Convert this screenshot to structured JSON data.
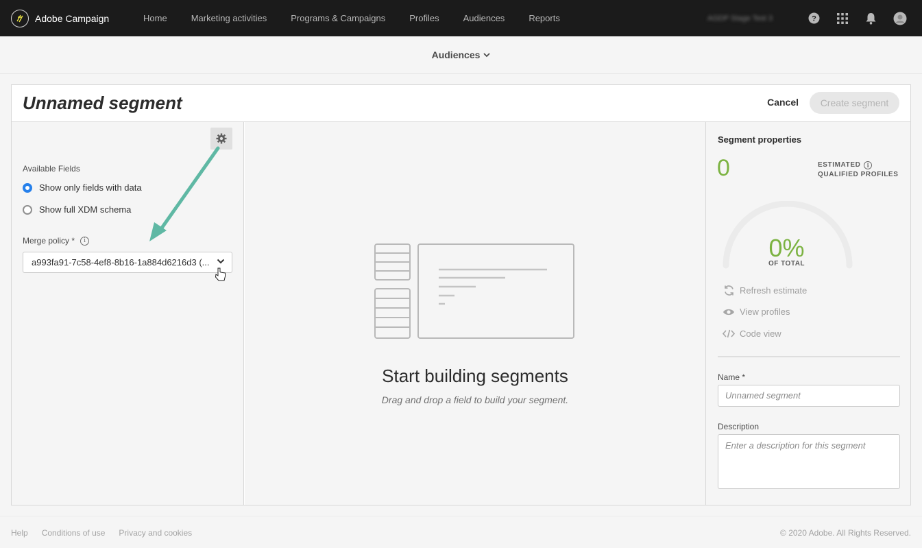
{
  "app": {
    "name": "Adobe Campaign",
    "org_name": "AGDP Stage Test 3"
  },
  "topnav": {
    "items": [
      {
        "label": "Home"
      },
      {
        "label": "Marketing activities"
      },
      {
        "label": "Programs & Campaigns"
      },
      {
        "label": "Profiles"
      },
      {
        "label": "Audiences"
      },
      {
        "label": "Reports"
      }
    ],
    "icons": [
      "help-icon",
      "apps-grid-icon",
      "notification-bell-icon",
      "user-avatar-icon"
    ]
  },
  "subheader": {
    "title": "Audiences"
  },
  "segment": {
    "title": "Unnamed segment",
    "cancel_label": "Cancel",
    "create_label": "Create segment"
  },
  "left_panel": {
    "available_fields_label": "Available Fields",
    "options": [
      {
        "label": "Show only fields with data",
        "selected": true
      },
      {
        "label": "Show full XDM schema",
        "selected": false
      }
    ],
    "merge_policy_label": "Merge policy *",
    "merge_policy_value": "a993fa91-7c58-4ef8-8b16-1a884d6216d3 (..."
  },
  "center_panel": {
    "empty_title": "Start building segments",
    "empty_subtitle": "Drag and drop a field to build your segment."
  },
  "right_panel": {
    "title": "Segment properties",
    "estimated_count": "0",
    "estimated_label_line1": "ESTIMATED",
    "estimated_label_line2": "QUALIFIED PROFILES",
    "gauge_percent": "0%",
    "gauge_value": 0,
    "gauge_label": "OF TOTAL",
    "actions": [
      {
        "label": "Refresh estimate",
        "icon": "refresh-icon"
      },
      {
        "label": "View profiles",
        "icon": "eye-icon"
      },
      {
        "label": "Code view",
        "icon": "code-icon"
      }
    ],
    "name_label": "Name *",
    "name_placeholder": "Unnamed segment",
    "description_label": "Description",
    "description_placeholder": "Enter a description for this segment"
  },
  "footer": {
    "links": [
      "Help",
      "Conditions of use",
      "Privacy and cookies"
    ],
    "copyright": "© 2020 Adobe. All Rights Reserved."
  },
  "colors": {
    "accent": "#2680eb",
    "positive": "#7cb342",
    "topnav_bg": "#1b1b1b",
    "annotation_arrow": "#5fb8a4"
  }
}
